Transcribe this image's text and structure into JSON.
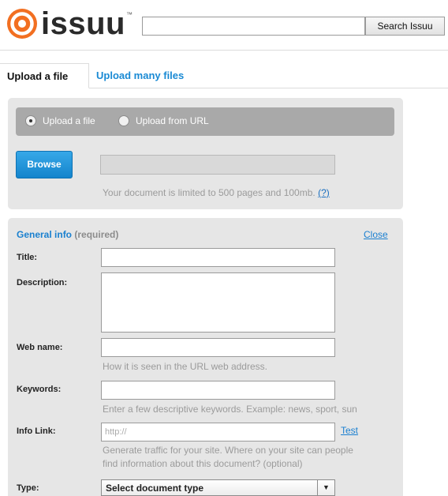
{
  "header": {
    "logo_text": "issuu",
    "logo_tm": "™",
    "brand_color": "#f26f21",
    "search_placeholder": "",
    "search_button_label": "Search Issuu"
  },
  "tabs": {
    "active_label": "Upload a file",
    "other_label": "Upload many files"
  },
  "upload": {
    "mode_options": [
      {
        "label": "Upload a file",
        "selected": true
      },
      {
        "label": "Upload from URL",
        "selected": false
      }
    ],
    "browse_label": "Browse",
    "limit_note": "Your document is limited to 500 pages and 100mb.",
    "help_link": "(?)"
  },
  "general_info": {
    "title": "General info",
    "required_note": "(required)",
    "close_label": "Close",
    "fields": {
      "title_label": "Title:",
      "description_label": "Description:",
      "webname_label": "Web name:",
      "webname_hint": "How it is seen in the URL web address.",
      "keywords_label": "Keywords:",
      "keywords_hint": "Enter a few descriptive keywords. Example: news, sport, sun",
      "infolink_label": "Info Link:",
      "infolink_placeholder": "http://",
      "infolink_test": "Test",
      "infolink_hint_1": "Generate traffic for your site. Where on your site can people",
      "infolink_hint_2": "find information about this document? (optional)",
      "type_label": "Type:",
      "type_selected": "Select document type"
    }
  }
}
